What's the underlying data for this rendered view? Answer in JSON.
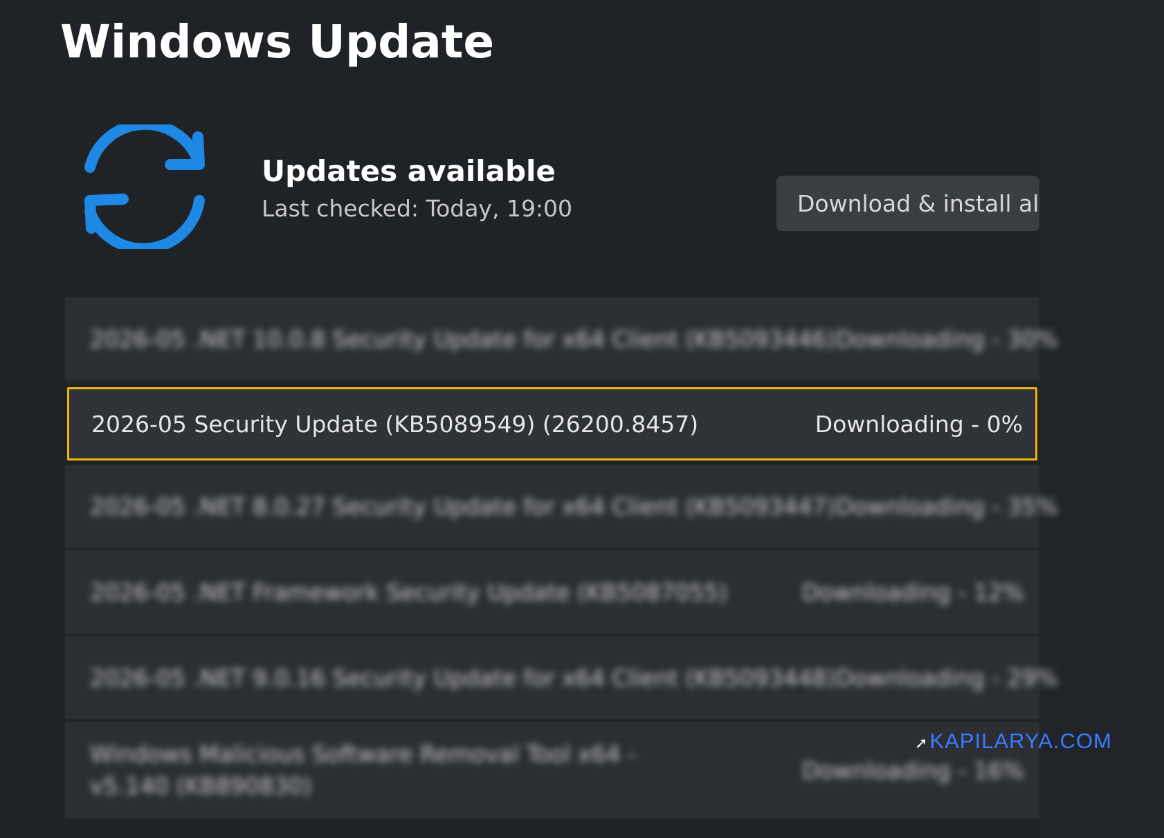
{
  "page": {
    "title": "Windows Update"
  },
  "status": {
    "icon": "sync-icon",
    "title": "Updates available",
    "last_checked": "Last checked: Today, 19:00"
  },
  "actions": {
    "download_all_label": "Download & install all"
  },
  "updates": [
    {
      "name": "2026-05 .NET 10.0.8 Security Update for x64 Client (KB5093446)",
      "status": "Downloading - 30%",
      "blurred": true
    },
    {
      "name": "2026-05 Security Update (KB5089549) (26200.8457)",
      "status": "Downloading - 0%",
      "blurred": false,
      "highlighted": true
    },
    {
      "name": "2026-05 .NET 8.0.27 Security Update for x64 Client (KB5093447)",
      "status": "Downloading - 35%",
      "blurred": true
    },
    {
      "name": "2026-05 .NET Framework Security Update (KB5087055)",
      "status": "Downloading - 12%",
      "blurred": true
    },
    {
      "name": "2026-05 .NET 9.0.16 Security Update for x64 Client (KB5093448)",
      "status": "Downloading - 29%",
      "blurred": true
    },
    {
      "name": "Windows Malicious Software Removal Tool x64 - v5.140 (KB890830)",
      "status": "Downloading - 16%",
      "blurred": true
    }
  ],
  "watermark": {
    "text": "KAPILARYA.COM"
  },
  "colors": {
    "accent_blue": "#1e88e5",
    "highlight_border": "#f2b400",
    "background": "#1f2227"
  }
}
